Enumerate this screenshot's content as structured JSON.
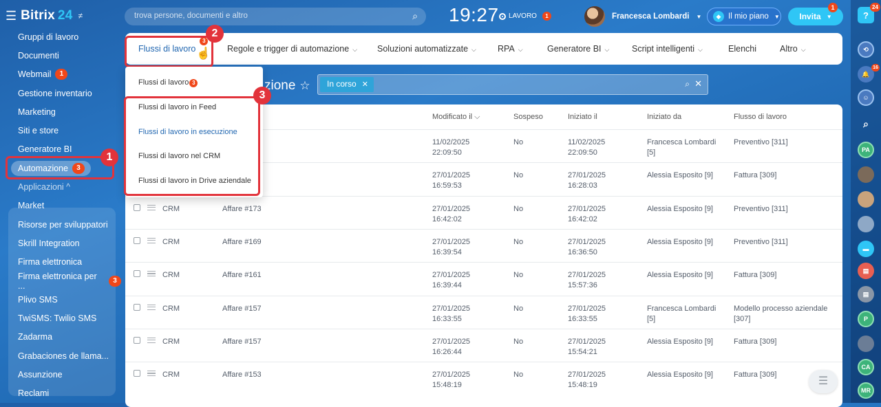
{
  "logo": {
    "brand": "Bitrix",
    "num": "24"
  },
  "sidebar": {
    "items": [
      {
        "label": "Gruppi di lavoro"
      },
      {
        "label": "Documenti"
      },
      {
        "label": "Webmail",
        "badge": "1"
      },
      {
        "label": "Gestione inventario"
      },
      {
        "label": "Marketing"
      },
      {
        "label": "Siti e store"
      },
      {
        "label": "Generatore BI"
      },
      {
        "label": "Automazione",
        "badge": "3"
      },
      {
        "label": "Applicazioni ^"
      },
      {
        "label": "Market"
      },
      {
        "label": "Risorse per sviluppatori"
      },
      {
        "label": "Skrill Integration"
      },
      {
        "label": "Firma elettronica"
      },
      {
        "label": "Firma elettronica per ...",
        "badge": "3"
      },
      {
        "label": "Plivo SMS"
      },
      {
        "label": "TwiSMS: Twilio SMS"
      },
      {
        "label": "Zadarma"
      },
      {
        "label": "Grabaciones de llama..."
      },
      {
        "label": "Assunzione"
      },
      {
        "label": "Reclami"
      }
    ]
  },
  "topbar": {
    "search_placeholder": "trova persone, documenti e altro",
    "clock": "19:27",
    "work_label": "LAVORO",
    "work_badge": "1",
    "user_name": "Francesca Lombardi",
    "plan_label": "Il mio piano",
    "invite_label": "Invita",
    "invite_badge": "1"
  },
  "tabs": [
    {
      "label": "Flussi di lavoro",
      "badge": "3"
    },
    {
      "label": "Regole e trigger di automazione"
    },
    {
      "label": "Soluzioni automatizzate"
    },
    {
      "label": "RPA"
    },
    {
      "label": "Generatore BI"
    },
    {
      "label": "Script intelligenti"
    },
    {
      "label": "Elenchi"
    },
    {
      "label": "Altro"
    }
  ],
  "dropdown": {
    "items": [
      {
        "label": "Flussi di lavoro",
        "badge": "3"
      },
      {
        "label": "Flussi di lavoro in Feed"
      },
      {
        "label": "Flussi di lavoro in esecuzione"
      },
      {
        "label": "Flussi di lavoro nel CRM"
      },
      {
        "label": "Flussi di lavoro in Drive aziendale"
      }
    ]
  },
  "page": {
    "title": "zione",
    "filter_chip": "In corso"
  },
  "table": {
    "headers": [
      "Modificato il",
      "Sospeso",
      "Iniziato il",
      "Iniziato da",
      "Flusso di lavoro"
    ],
    "rows": [
      {
        "module": "",
        "doc": "",
        "mod": "11/02/2025 22:09:50",
        "sus": "No",
        "start": "11/02/2025 22:09:50",
        "by": "Francesca Lombardi [5]",
        "flow": "Preventivo [311]"
      },
      {
        "module": "",
        "doc": "",
        "mod": "27/01/2025 16:59:53",
        "sus": "No",
        "start": "27/01/2025 16:28:03",
        "by": "Alessia Esposito [9]",
        "flow": "Fattura [309]"
      },
      {
        "module": "CRM",
        "doc": "Affare #173",
        "mod": "27/01/2025 16:42:02",
        "sus": "No",
        "start": "27/01/2025 16:42:02",
        "by": "Alessia Esposito [9]",
        "flow": "Preventivo [311]"
      },
      {
        "module": "CRM",
        "doc": "Affare #169",
        "mod": "27/01/2025 16:39:54",
        "sus": "No",
        "start": "27/01/2025 16:36:50",
        "by": "Alessia Esposito [9]",
        "flow": "Preventivo [311]"
      },
      {
        "module": "CRM",
        "doc": "Affare #161",
        "mod": "27/01/2025 16:39:44",
        "sus": "No",
        "start": "27/01/2025 15:57:36",
        "by": "Alessia Esposito [9]",
        "flow": "Fattura [309]"
      },
      {
        "module": "CRM",
        "doc": "Affare #157",
        "mod": "27/01/2025 16:33:55",
        "sus": "No",
        "start": "27/01/2025 16:33:55",
        "by": "Francesca Lombardi [5]",
        "flow": "Modello processo aziendale [307]"
      },
      {
        "module": "CRM",
        "doc": "Affare #157",
        "mod": "27/01/2025 16:26:44",
        "sus": "No",
        "start": "27/01/2025 15:54:21",
        "by": "Alessia Esposito [9]",
        "flow": "Fattura [309]"
      },
      {
        "module": "CRM",
        "doc": "Affare #153",
        "mod": "27/01/2025 15:48:19",
        "sus": "No",
        "start": "27/01/2025 15:48:19",
        "by": "Alessia Esposito [9]",
        "flow": "Fattura [309]"
      }
    ]
  },
  "rail": {
    "notif_badge": "24",
    "bell_badge": "16",
    "avatars": [
      "PA",
      "P",
      "CA",
      "MR"
    ]
  },
  "callouts": [
    "1",
    "2",
    "3"
  ],
  "colors": {
    "accent": "#2fc6f6",
    "badge": "#f0471a",
    "highlight": "#e2333b",
    "link": "#2066b0"
  }
}
